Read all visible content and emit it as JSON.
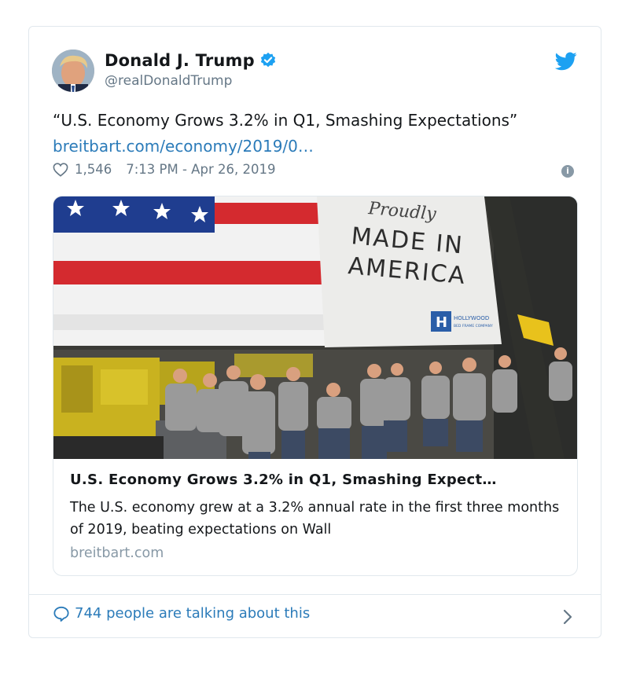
{
  "tweet": {
    "author_name": "Donald J. Trump",
    "author_handle": "@realDonaldTrump",
    "text": "“U.S. Economy Grows 3.2% in Q1, Smashing Expectations”",
    "link_text": "breitbart.com/economy/2019/0…",
    "likes": "1,546",
    "timestamp": "7:13 PM - Apr 26, 2019"
  },
  "link_card": {
    "title": "U.S. Economy Grows 3.2% in Q1, Smashing Expect…",
    "description": "The U.S. economy grew at a 3.2% annual rate in the first three months of 2019, beating expectations on Wall",
    "domain": "breitbart.com",
    "image": {
      "banner_line1": "Proudly",
      "banner_line2": "MADE IN",
      "banner_line3": "AMERICA",
      "logo_text": "HOLLYWOOD",
      "logo_subtext": "BED FRAME COMPANY"
    }
  },
  "footer": {
    "talking_text": "744 people are talking about this"
  },
  "colors": {
    "link_blue": "#2b7bb9",
    "verified_blue": "#1da1f2",
    "muted_gray": "#657786",
    "border": "#e1e8ed"
  },
  "icons": [
    "verified-icon",
    "twitter-bird-icon",
    "heart-icon",
    "info-icon",
    "speech-bubble-icon",
    "chevron-right-icon"
  ]
}
